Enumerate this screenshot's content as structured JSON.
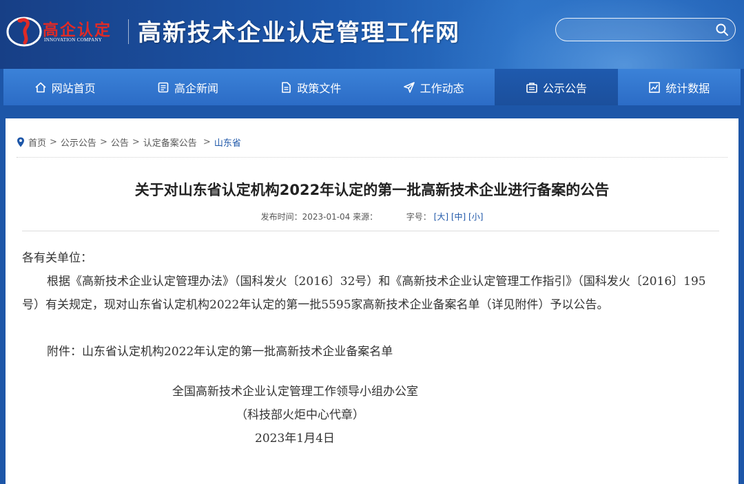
{
  "header": {
    "logo_cn": "高企认定",
    "logo_en": "INNOVATION COMPANY",
    "site_title": "高新技术企业认定管理工作网",
    "search_placeholder": ""
  },
  "nav": {
    "items": [
      {
        "label": "网站首页",
        "icon": "home-icon"
      },
      {
        "label": "高企新闻",
        "icon": "news-icon"
      },
      {
        "label": "政策文件",
        "icon": "document-icon"
      },
      {
        "label": "工作动态",
        "icon": "send-icon"
      },
      {
        "label": "公示公告",
        "icon": "notice-icon",
        "active": true
      },
      {
        "label": "统计数据",
        "icon": "chart-icon"
      }
    ]
  },
  "breadcrumb": {
    "items": [
      "首页",
      "公示公告",
      "公告",
      "认定备案公告",
      "山东省"
    ]
  },
  "article": {
    "title": "关于对山东省认定机构2022年认定的第一批高新技术企业进行备案的公告",
    "meta_published": "发布时间：2023-01-04 来源：",
    "meta_fontsize_label": "字号：",
    "font_large": "[大]",
    "font_medium": "[中]",
    "font_small": "[小]",
    "salutation": "各有关单位：",
    "paragraph1": "根据《高新技术企业认定管理办法》（国科发火〔2016〕32号）和《高新技术企业认定管理工作指引》（国科发火〔2016〕195号）有关规定，现对山东省认定机构2022年认定的第一批5595家高新技术企业备案名单（详见附件）予以公告。",
    "attachment": "附件：山东省认定机构2022年认定的第一批高新技术企业备案名单",
    "sign_org": "全国高新技术企业认定管理工作领导小组办公室",
    "sign_note": "（科技部火炬中心代章）",
    "sign_date": "2023年1月4日"
  },
  "colors": {
    "header_blue": "#1d56a8",
    "nav_blue": "#2f73cc",
    "nav_active": "#1b4f9c",
    "logo_red": "#e02a26"
  }
}
